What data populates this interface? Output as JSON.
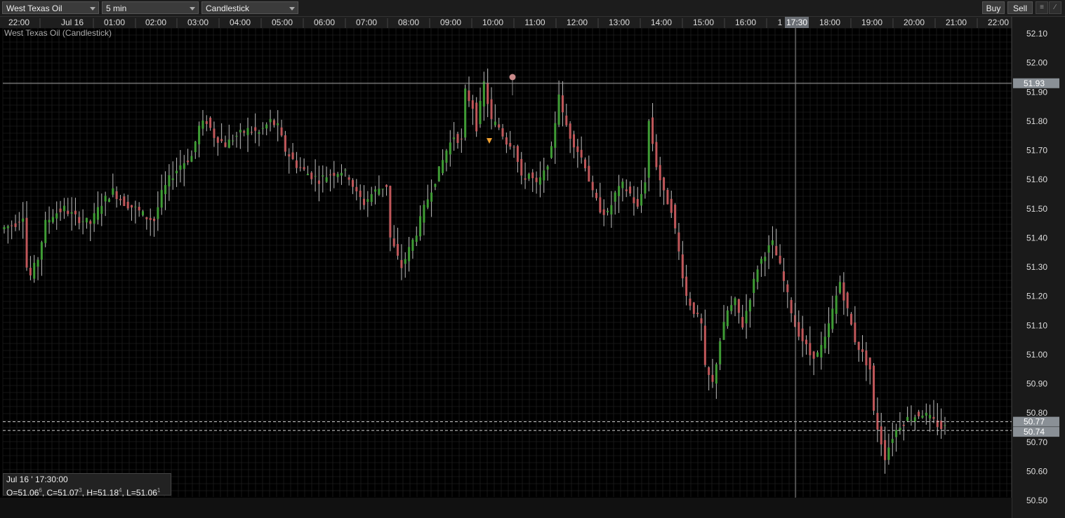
{
  "toolbar": {
    "instrument": "West Texas Oil",
    "interval": "5 min",
    "chart_type": "Candlestick",
    "buy_label": "Buy",
    "sell_label": "Sell"
  },
  "chart_label": "West Texas Oil (Candlestick)",
  "cursor_time_label": "17:30",
  "ohlc": {
    "date": "Jul 16 ' 17:30:00",
    "o": "51.06",
    "o_sup": "6",
    "c": "51.07",
    "c_sup": "3",
    "h": "51.18",
    "h_sup": "4",
    "l": "51.06",
    "l_sup": "1"
  },
  "price_tags": {
    "high_line": "51.93",
    "current_a": "50.77",
    "current_b": "50.74"
  },
  "colors": {
    "up": "#3f9c35",
    "down": "#c0575a",
    "wick": "#bdbdbd",
    "grid": "#262626",
    "background": "#000000"
  },
  "flag_icons": [
    "au-flag-icon",
    "ch-flag-icon",
    "eu-flag-icon",
    "eu-flag-icon",
    "us-flag-icon",
    "us-flag-icon",
    "us-flag-icon"
  ],
  "chart_data": {
    "type": "candlestick",
    "title": "West Texas Oil (Candlestick)",
    "interval": "5 min",
    "time_ticks": [
      "22:00",
      "Jul 16",
      "01:00",
      "02:00",
      "03:00",
      "04:00",
      "05:00",
      "06:00",
      "07:00",
      "08:00",
      "09:00",
      "10:00",
      "11:00",
      "12:00",
      "13:00",
      "14:00",
      "15:00",
      "16:00",
      "1",
      "18:00",
      "19:00",
      "20:00",
      "21:00",
      "22:00"
    ],
    "price_ticks": [
      "52.10",
      "52.00",
      "51.90",
      "51.80",
      "51.70",
      "51.60",
      "51.50",
      "51.40",
      "51.30",
      "51.20",
      "51.10",
      "51.00",
      "50.90",
      "50.80",
      "50.70",
      "50.60",
      "50.50"
    ],
    "ylim": [
      50.5,
      52.15
    ],
    "reference_lines": [
      51.93,
      50.77,
      50.74
    ],
    "path": [
      [
        0,
        51.43
      ],
      [
        4,
        51.45
      ],
      [
        6,
        51.48
      ],
      [
        7,
        51.3
      ],
      [
        8,
        51.27
      ],
      [
        10,
        51.33
      ],
      [
        12,
        51.45
      ],
      [
        14,
        51.48
      ],
      [
        17,
        51.5
      ],
      [
        20,
        51.47
      ],
      [
        24,
        51.45
      ],
      [
        27,
        51.52
      ],
      [
        30,
        51.56
      ],
      [
        33,
        51.52
      ],
      [
        36,
        51.5
      ],
      [
        39,
        51.47
      ],
      [
        41,
        51.46
      ],
      [
        43,
        51.55
      ],
      [
        45,
        51.6
      ],
      [
        48,
        51.65
      ],
      [
        51,
        51.68
      ],
      [
        53,
        51.78
      ],
      [
        55,
        51.8
      ],
      [
        57,
        51.75
      ],
      [
        60,
        51.72
      ],
      [
        63,
        51.75
      ],
      [
        66,
        51.77
      ],
      [
        69,
        51.76
      ],
      [
        72,
        51.8
      ],
      [
        74,
        51.78
      ],
      [
        76,
        51.7
      ],
      [
        79,
        51.65
      ],
      [
        82,
        51.62
      ],
      [
        85,
        51.6
      ],
      [
        88,
        51.62
      ],
      [
        91,
        51.63
      ],
      [
        93,
        51.61
      ],
      [
        95,
        51.55
      ],
      [
        97,
        51.52
      ],
      [
        99,
        51.55
      ],
      [
        101,
        51.57
      ],
      [
        103,
        51.58
      ],
      [
        104,
        51.4
      ],
      [
        106,
        51.33
      ],
      [
        107,
        51.3
      ],
      [
        109,
        51.36
      ],
      [
        111,
        51.42
      ],
      [
        113,
        51.5
      ],
      [
        115,
        51.57
      ],
      [
        117,
        51.63
      ],
      [
        119,
        51.7
      ],
      [
        121,
        51.75
      ],
      [
        123,
        51.73
      ],
      [
        124,
        51.9
      ],
      [
        126,
        51.85
      ],
      [
        127,
        51.78
      ],
      [
        129,
        51.93
      ],
      [
        131,
        51.8
      ],
      [
        133,
        51.78
      ],
      [
        135,
        51.73
      ],
      [
        137,
        51.72
      ],
      [
        139,
        51.6
      ],
      [
        141,
        51.62
      ],
      [
        143,
        51.58
      ],
      [
        145,
        51.62
      ],
      [
        147,
        51.7
      ],
      [
        149,
        51.9
      ],
      [
        150,
        51.82
      ],
      [
        152,
        51.75
      ],
      [
        154,
        51.7
      ],
      [
        156,
        51.65
      ],
      [
        158,
        51.55
      ],
      [
        160,
        51.5
      ],
      [
        162,
        51.48
      ],
      [
        164,
        51.55
      ],
      [
        166,
        51.58
      ],
      [
        168,
        51.55
      ],
      [
        170,
        51.5
      ],
      [
        172,
        51.6
      ],
      [
        173,
        51.8
      ],
      [
        175,
        51.65
      ],
      [
        177,
        51.55
      ],
      [
        179,
        51.5
      ],
      [
        181,
        51.35
      ],
      [
        183,
        51.2
      ],
      [
        185,
        51.15
      ],
      [
        187,
        51.1
      ],
      [
        188,
        50.95
      ],
      [
        190,
        50.9
      ],
      [
        192,
        51.05
      ],
      [
        194,
        51.15
      ],
      [
        196,
        51.18
      ],
      [
        198,
        51.1
      ],
      [
        200,
        51.2
      ],
      [
        202,
        51.3
      ],
      [
        204,
        51.35
      ],
      [
        206,
        51.38
      ],
      [
        208,
        51.3
      ],
      [
        210,
        51.2
      ],
      [
        212,
        51.1
      ],
      [
        214,
        51.05
      ],
      [
        216,
        51.0
      ],
      [
        218,
        51.0
      ],
      [
        220,
        51.05
      ],
      [
        222,
        51.15
      ],
      [
        224,
        51.25
      ],
      [
        226,
        51.15
      ],
      [
        228,
        51.05
      ],
      [
        230,
        51.0
      ],
      [
        232,
        50.95
      ],
      [
        233,
        50.8
      ],
      [
        235,
        50.7
      ],
      [
        236,
        50.65
      ],
      [
        238,
        50.72
      ],
      [
        240,
        50.76
      ],
      [
        242,
        50.78
      ],
      [
        244,
        50.79
      ],
      [
        246,
        50.8
      ],
      [
        248,
        50.78
      ],
      [
        250,
        50.76
      ],
      [
        251,
        50.75
      ]
    ],
    "bars": 252
  }
}
